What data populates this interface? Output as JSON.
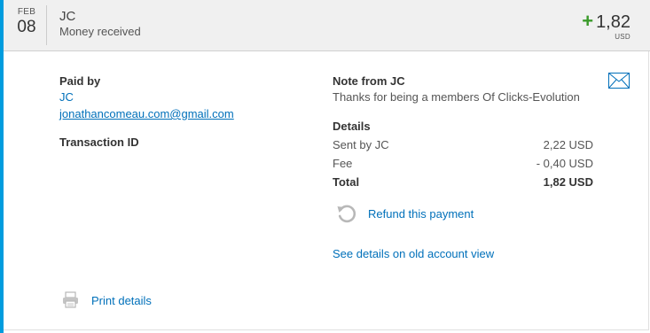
{
  "header": {
    "date_month": "FEB",
    "date_day": "08",
    "counterparty": "JC",
    "transaction_type": "Money received",
    "amount_sign": "+",
    "amount": "1,82",
    "currency": "USD"
  },
  "paid_by": {
    "label": "Paid by",
    "name": "JC",
    "email": "jonathancomeau.com@gmail.com"
  },
  "transaction_id": {
    "label": "Transaction ID"
  },
  "note": {
    "label": "Note from JC",
    "text": "Thanks for being a members Of Clicks-Evolution"
  },
  "details": {
    "label": "Details",
    "rows": [
      {
        "label": "Sent by JC",
        "value": "2,22 USD"
      },
      {
        "label": "Fee",
        "value": "- 0,40 USD"
      },
      {
        "label": "Total",
        "value": "1,82 USD"
      }
    ]
  },
  "actions": {
    "refund_label": "Refund this payment",
    "old_view_label": "See details on old account view",
    "print_label": "Print details"
  },
  "icons": {
    "mail": "mail-icon",
    "refund": "refund-icon",
    "print": "printer-icon"
  },
  "colors": {
    "accent": "#009cde",
    "link": "#0070ba",
    "positive": "#3a9a2a",
    "header_bg": "#f0f0f0"
  }
}
